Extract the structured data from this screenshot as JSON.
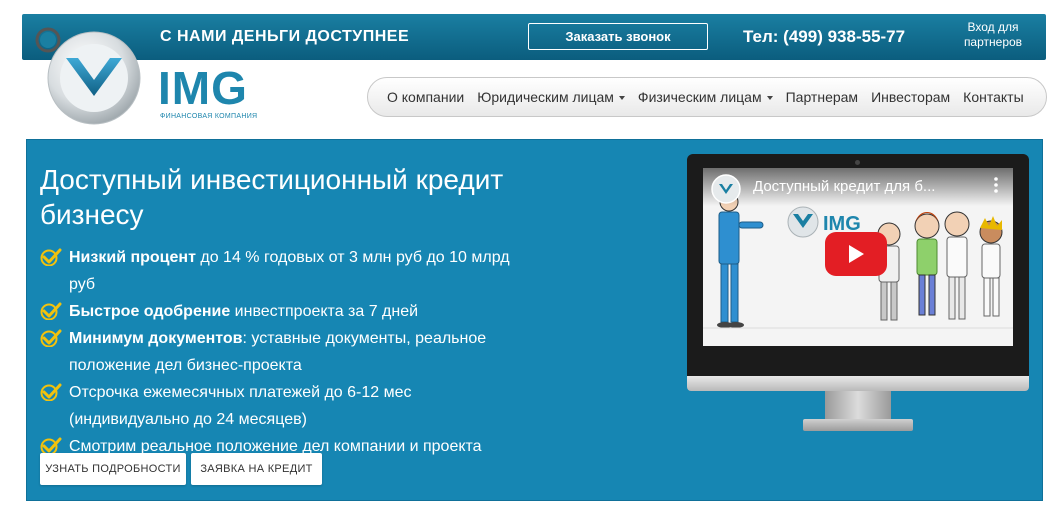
{
  "topbar": {
    "slogan": "С НАМИ ДЕНЬГИ ДОСТУПНЕЕ",
    "order_call": "Заказать звонок",
    "phone": "Тел: (499) 938-55-77",
    "partner_login": "Вход для партнеров"
  },
  "logo": {
    "name": "IMG",
    "subtitle": "Финансовая компания"
  },
  "nav": {
    "items": [
      {
        "label": "О компании",
        "dropdown": false
      },
      {
        "label": "Юридическим лицам",
        "dropdown": true
      },
      {
        "label": "Физическим лицам",
        "dropdown": true
      },
      {
        "label": "Партнерам",
        "dropdown": false
      },
      {
        "label": "Инвесторам",
        "dropdown": false
      },
      {
        "label": "Контакты",
        "dropdown": false
      }
    ]
  },
  "hero": {
    "title": "Доступный инвестиционный кредит бизнесу",
    "features": [
      {
        "bold": "Низкий процент",
        "text": " до 14 % годовых от 3 млн руб до 10 млрд руб"
      },
      {
        "bold": "Быстрое одобрение",
        "text": " инвестпроекта за 7 дней"
      },
      {
        "bold": "Минимум документов",
        "text": ": уставные документы, реальное положение дел бизнес-проекта"
      },
      {
        "bold": "",
        "text": "Отсрочка ежемесячных платежей до 6-12 мес (индивидуально до 24 месяцев)"
      },
      {
        "bold": "",
        "text": "Смотрим реальное положение дел компании и проекта"
      }
    ],
    "btn_more": "Узнать подробности",
    "btn_apply": "Заявка на кредит"
  },
  "video": {
    "title": "Доступный кредит для б...",
    "brand": "IMG"
  },
  "colors": {
    "topbar": "#0f6a8c",
    "hero_bg": "#1686b3",
    "logo_blue": "#1e86ad",
    "check_yellow": "#f2c20d",
    "play_red": "#e31e24"
  }
}
